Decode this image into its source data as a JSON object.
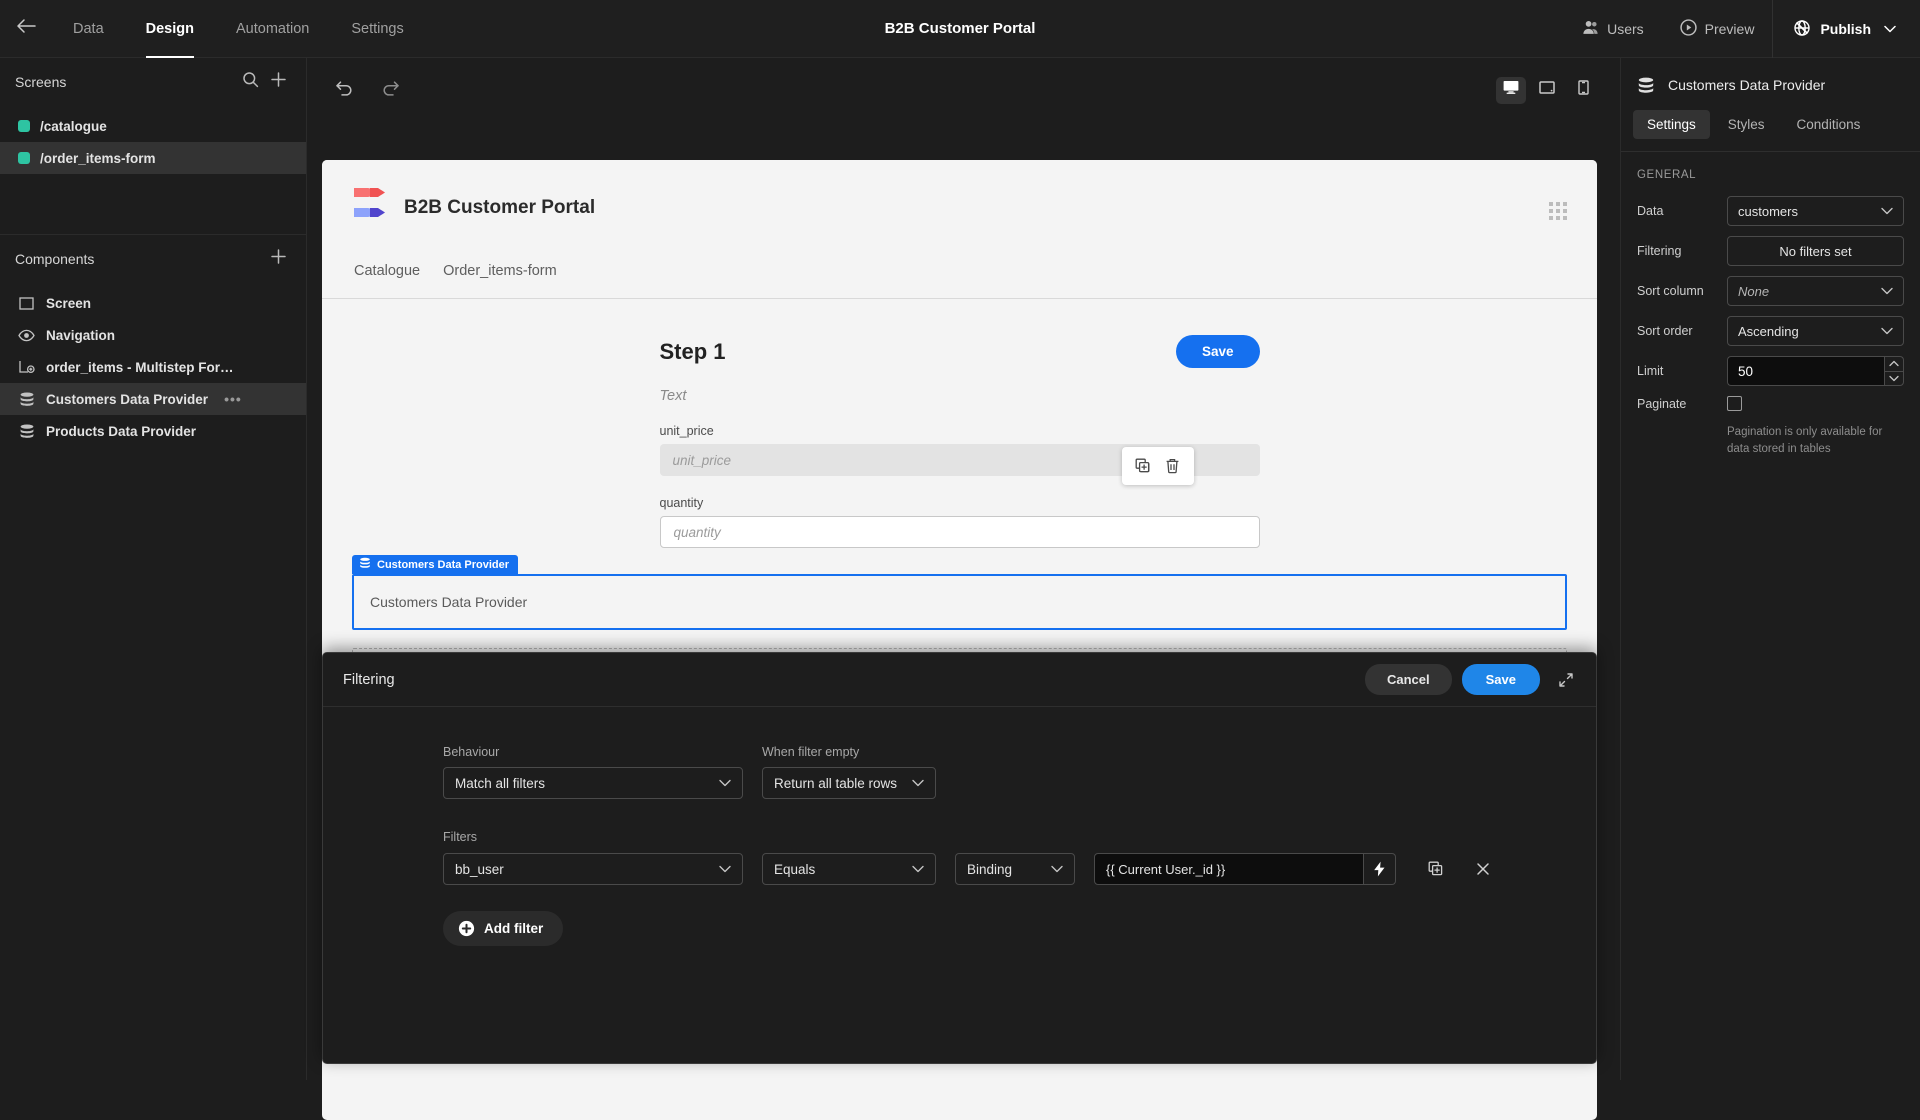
{
  "topbar": {
    "back_icon": "arrow-left-icon",
    "nav": [
      {
        "label": "Data",
        "active": false
      },
      {
        "label": "Design",
        "active": true
      },
      {
        "label": "Automation",
        "active": false
      },
      {
        "label": "Settings",
        "active": false
      }
    ],
    "title": "B2B Customer Portal",
    "users_label": "Users",
    "preview_label": "Preview",
    "publish_label": "Publish"
  },
  "left_panel": {
    "screens_title": "Screens",
    "screens": [
      {
        "label": "/catalogue",
        "color": "#2ec4a2",
        "selected": false
      },
      {
        "label": "/order_items-form",
        "color": "#2ec4a2",
        "selected": true
      }
    ],
    "components_title": "Components",
    "components": [
      {
        "label": "Screen",
        "icon": "screen-icon",
        "selected": false,
        "menu": false
      },
      {
        "label": "Navigation",
        "icon": "eye-icon",
        "selected": false,
        "menu": false
      },
      {
        "label": "order_items - Multistep For…",
        "icon": "multistep-form-icon",
        "selected": false,
        "menu": false
      },
      {
        "label": "Customers Data Provider",
        "icon": "database-icon",
        "selected": true,
        "menu": true
      },
      {
        "label": "Products Data Provider",
        "icon": "database-icon",
        "selected": false,
        "menu": false
      }
    ],
    "menu_dots": "•••"
  },
  "canvas_toolbar": {
    "undo_icon": "undo-icon",
    "redo_icon": "redo-icon",
    "devices": [
      {
        "name": "desktop",
        "active": true
      },
      {
        "name": "tablet",
        "active": false
      },
      {
        "name": "mobile",
        "active": false
      }
    ]
  },
  "app_preview": {
    "app_name": "B2B Customer Portal",
    "nav_links": [
      "Catalogue",
      "Order_items-form"
    ],
    "grid_icon": "grid-dots-icon",
    "form": {
      "step_title": "Step 1",
      "save_label": "Save",
      "text_placeholder": "Text",
      "fields": [
        {
          "label": "unit_price",
          "placeholder": "unit_price",
          "disabled": true
        },
        {
          "label": "quantity",
          "placeholder": "quantity",
          "disabled": false
        }
      ],
      "float_actions": [
        "duplicate-icon",
        "delete-icon"
      ]
    },
    "data_providers": [
      {
        "label": "Customers Data Provider",
        "tag": "Customers Data Provider",
        "selected": true
      },
      {
        "label": "Products Data Provider",
        "tag": "",
        "selected": false
      }
    ]
  },
  "drawer": {
    "title": "Filtering",
    "cancel_label": "Cancel",
    "save_label": "Save",
    "expand_icon": "expand-icon",
    "behaviour_label": "Behaviour",
    "behaviour_value": "Match all filters",
    "when_empty_label": "When filter empty",
    "when_empty_value": "Return all table rows",
    "filters_label": "Filters",
    "filter_rows": [
      {
        "field": "bb_user",
        "operator": "Equals",
        "value_type": "Binding",
        "value": "{{ Current User._id }}",
        "lightning_icon": "lightning-icon",
        "duplicate_icon": "duplicate-icon",
        "remove_icon": "close-icon"
      }
    ],
    "add_filter_label": "Add filter"
  },
  "right_panel": {
    "title": "Customers Data Provider",
    "icon": "database-icon",
    "tabs": [
      {
        "label": "Settings",
        "active": true
      },
      {
        "label": "Styles",
        "active": false
      },
      {
        "label": "Conditions",
        "active": false
      }
    ],
    "section_label": "GENERAL",
    "props": [
      {
        "label": "Data",
        "value": "customers",
        "type": "select"
      },
      {
        "label": "Filtering",
        "value": "No filters set",
        "type": "button"
      },
      {
        "label": "Sort column",
        "value": "None",
        "type": "select-italic"
      },
      {
        "label": "Sort order",
        "value": "Ascending",
        "type": "select"
      },
      {
        "label": "Limit",
        "value": "50",
        "type": "stepper"
      },
      {
        "label": "Paginate",
        "value": "",
        "type": "checkbox"
      }
    ],
    "hint": "Pagination is only available for data stored in tables"
  },
  "colors": {
    "accent_blue": "#1570ef",
    "drawer_blue": "#1f86e8",
    "screen_green": "#2ec4a2",
    "canvas_bg": "#f4f4f4",
    "app_bg": "#1d1d1d"
  }
}
